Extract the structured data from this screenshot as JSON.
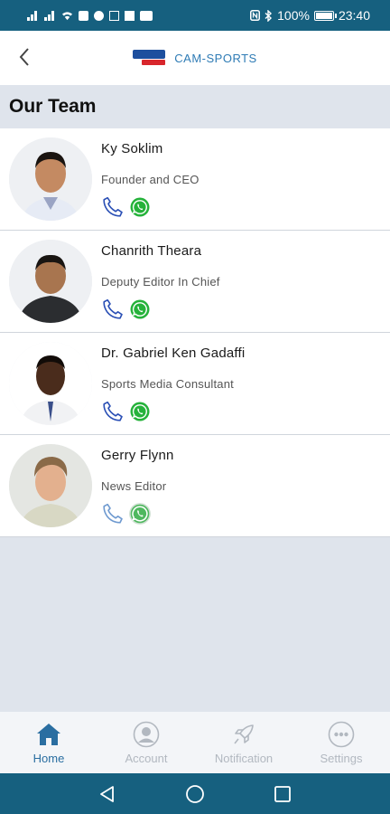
{
  "status_bar": {
    "battery": "100%",
    "battery_level": 1.0,
    "time": "23:40"
  },
  "header": {
    "brand": "CAM-SPORTS"
  },
  "section": {
    "title": "Our Team"
  },
  "team": [
    {
      "name": "Ky Soklim",
      "role": "Founder and CEO"
    },
    {
      "name": "Chanrith Theara",
      "role": "Deputy Editor In Chief"
    },
    {
      "name": "Dr. Gabriel Ken Gadaffi",
      "role": "Sports Media Consultant"
    },
    {
      "name": "Gerry Flynn",
      "role": "News Editor"
    }
  ],
  "bottom_nav": {
    "items": [
      {
        "label": "Home",
        "icon": "home-icon",
        "active": true
      },
      {
        "label": "Account",
        "icon": "account-icon",
        "active": false
      },
      {
        "label": "Notification",
        "icon": "rocket-icon",
        "active": false
      },
      {
        "label": "Settings",
        "icon": "more-icon",
        "active": false
      }
    ]
  },
  "colors": {
    "status_bar": "#16607f",
    "brand": "#2e7bb5",
    "phone": "#2a4fb5",
    "whatsapp": "#25b23a",
    "nav_active": "#2a6ea1",
    "nav_inactive": "#b2b8c0"
  }
}
